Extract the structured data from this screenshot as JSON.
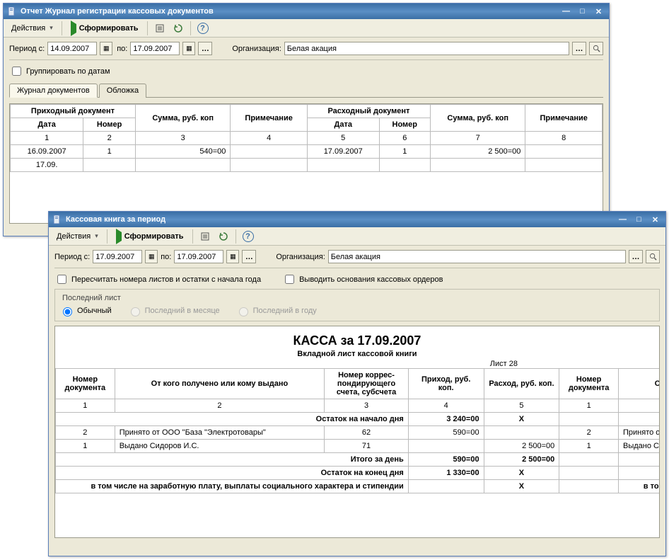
{
  "win1": {
    "title": "Отчет Журнал регистрации кассовых документов",
    "toolbar": {
      "actions": "Действия",
      "generate": "Сформировать"
    },
    "period": {
      "label_from": "Период с:",
      "date_from": "14.09.2007",
      "label_to": "по:",
      "date_to": "17.09.2007",
      "org_label": "Организация:",
      "org_value": "Белая акация"
    },
    "group_by_dates": "Группировать по датам",
    "tabs": {
      "journal": "Журнал документов",
      "cover": "Обложка"
    },
    "headers": {
      "income_doc": "Приходный документ",
      "expense_doc": "Расходный документ",
      "amount": "Сумма, руб. коп",
      "note": "Примечание",
      "date": "Дата",
      "number": "Номер"
    },
    "colnums": [
      "1",
      "2",
      "3",
      "4",
      "5",
      "6",
      "7",
      "8"
    ],
    "rows": [
      {
        "d1": "16.09.2007",
        "n1": "1",
        "s1": "540=00",
        "note1": "",
        "d2": "17.09.2007",
        "n2": "1",
        "s2": "2 500=00",
        "note2": ""
      },
      {
        "d1": "17.09.",
        "n1": "",
        "s1": "",
        "note1": "",
        "d2": "",
        "n2": "",
        "s2": "",
        "note2": ""
      }
    ]
  },
  "win2": {
    "title": "Кассовая книга за период",
    "toolbar": {
      "actions": "Действия",
      "generate": "Сформировать"
    },
    "period": {
      "label_from": "Период с:",
      "date_from": "17.09.2007",
      "label_to": "по:",
      "date_to": "17.09.2007",
      "org_label": "Организация:",
      "org_value": "Белая акация"
    },
    "chk_recount": "Пересчитать номера листов и остатки с начала года",
    "chk_print_basis": "Выводить основания кассовых ордеров",
    "fs_title": "Последний лист",
    "radio": {
      "normal": "Обычный",
      "month": "Последний в месяце",
      "year": "Последний в году"
    },
    "doc": {
      "title": "КАССА за 17.09.2007",
      "subtitle": "Вкладной лист кассовой книги",
      "sheet": "Лист 28",
      "h_docnum": "Номер документа",
      "h_from": "От кого получено или кому выдано",
      "h_corr": "Номер коррес- пондирующего счета, субсчета",
      "h_prihod": "Приход, руб. коп.",
      "h_rashod": "Расход, руб. коп.",
      "h_docnum2": "Номер документа",
      "h_from2": "От кого",
      "cnums": [
        "1",
        "2",
        "3",
        "4",
        "5",
        "1"
      ],
      "row_open_label": "Остаток на начало дня",
      "row_open_prihod": "3 240=00",
      "row_open_rashod": "X",
      "rows": [
        {
          "num": "2",
          "desc": "Принято от ООО \"База \"Электротовары\"",
          "corr": "62",
          "prihod": "590=00",
          "rashod": "",
          "num2": "2",
          "desc2": "Принято от ОО"
        },
        {
          "num": "1",
          "desc": "Выдано Сидоров И.С.",
          "corr": "71",
          "prihod": "",
          "rashod": "2 500=00",
          "num2": "1",
          "desc2": "Выдано Сидор"
        }
      ],
      "total_label": "Итого за день",
      "total_prihod": "590=00",
      "total_rashod": "2 500=00",
      "close_label": "Остаток на конец  дня",
      "close_prihod": "1 330=00",
      "close_rashod": "X",
      "salary_label": "в том числе на заработную плату, выплаты социального характера и стипендии",
      "salary_rashod": "X",
      "salary_label2": "в том числе      социа"
    }
  }
}
